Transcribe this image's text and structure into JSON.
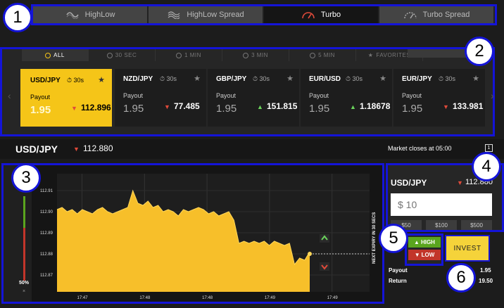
{
  "trade_types": [
    {
      "label": "HighLow",
      "icon": "highlow-icon",
      "active": false
    },
    {
      "label": "HighLow Spread",
      "icon": "highlow-spread-icon",
      "active": false
    },
    {
      "label": "Turbo",
      "icon": "turbo-gauge-icon",
      "active": true
    },
    {
      "label": "Turbo Spread",
      "icon": "turbo-spread-gauge-icon",
      "active": false
    }
  ],
  "callouts": [
    "1",
    "2",
    "3",
    "4",
    "5",
    "6"
  ],
  "filters": [
    {
      "label": "ALL",
      "active": true
    },
    {
      "label": "30 SEC",
      "active": false
    },
    {
      "label": "1 MIN",
      "active": false
    },
    {
      "label": "3 MIN",
      "active": false
    },
    {
      "label": "5 MIN",
      "active": false
    },
    {
      "label": "FAVORITES",
      "active": false
    }
  ],
  "assets": [
    {
      "symbol": "USD/JPY",
      "duration": "30s",
      "payout_label": "Payout",
      "payout": "1.95",
      "direction": "down",
      "price": "112.896",
      "selected": true
    },
    {
      "symbol": "NZD/JPY",
      "duration": "30s",
      "payout_label": "Payout",
      "payout": "1.95",
      "direction": "down",
      "price": "77.485",
      "selected": false
    },
    {
      "symbol": "GBP/JPY",
      "duration": "30s",
      "payout_label": "Payout",
      "payout": "1.95",
      "direction": "up",
      "price": "151.815",
      "selected": false
    },
    {
      "symbol": "EUR/USD",
      "duration": "30s",
      "payout_label": "Payout",
      "payout": "1.95",
      "direction": "up",
      "price": "1.18678",
      "selected": false
    },
    {
      "symbol": "EUR/JPY",
      "duration": "30s",
      "payout_label": "Payout",
      "payout": "1.95",
      "direction": "down",
      "price": "133.981",
      "selected": false
    }
  ],
  "header": {
    "symbol": "USD/JPY",
    "price": "112.880",
    "market_close": "Market closes at 05:00",
    "icon_text": "1"
  },
  "chart": {
    "y_ticks": [
      "112.91",
      "112.90",
      "112.89",
      "112.88",
      "112.87"
    ],
    "x_ticks": [
      "17:47",
      "17:48",
      "17:48",
      "17:49",
      "17:49"
    ],
    "expiry_label": "NEXT EXPIRY IN 30 SECS",
    "sentiment": "50%",
    "close_glyph": "×"
  },
  "chart_data": {
    "type": "area",
    "ylim": [
      112.862,
      112.918
    ],
    "x": [
      0,
      2,
      4,
      6,
      8,
      10,
      12,
      14,
      16,
      18,
      20,
      22,
      24,
      26,
      28,
      30,
      32,
      34,
      36,
      38,
      40,
      42,
      44,
      46,
      48,
      50,
      52,
      54,
      56,
      58,
      60,
      62,
      64,
      66,
      68,
      70,
      72,
      74,
      76,
      78,
      80,
      82,
      84,
      86,
      88,
      90,
      92,
      94,
      96,
      98,
      100
    ],
    "values": [
      112.901,
      112.902,
      112.9,
      112.901,
      112.899,
      112.901,
      112.9,
      112.899,
      112.901,
      112.902,
      112.9,
      112.899,
      112.9,
      112.901,
      112.902,
      112.91,
      112.904,
      112.903,
      112.905,
      112.902,
      112.903,
      112.9,
      112.901,
      112.9,
      112.898,
      112.901,
      112.9,
      112.901,
      112.902,
      112.901,
      112.899,
      112.9,
      112.898,
      112.899,
      112.9,
      112.896,
      112.885,
      112.886,
      112.885,
      112.886,
      112.885,
      112.886,
      112.884,
      112.886,
      112.885,
      112.884,
      112.885,
      112.875,
      112.878,
      112.877,
      112.881
    ],
    "reference_value": 112.88,
    "reference_x": 100
  },
  "trade": {
    "symbol": "USD/JPY",
    "price": "112.880",
    "amount_placeholder": "$ 10",
    "amounts": [
      "$50",
      "$100",
      "$500"
    ],
    "high_label": "HIGH",
    "low_label": "LOW",
    "invest_label": "INVEST",
    "payout_label": "Payout",
    "payout_value": "1.95",
    "return_label": "Return",
    "return_value": "19.50"
  },
  "colors": {
    "accent": "#f5c518",
    "up": "#6bd45c",
    "down": "#e04a3a",
    "callout_border": "#1414d8"
  }
}
